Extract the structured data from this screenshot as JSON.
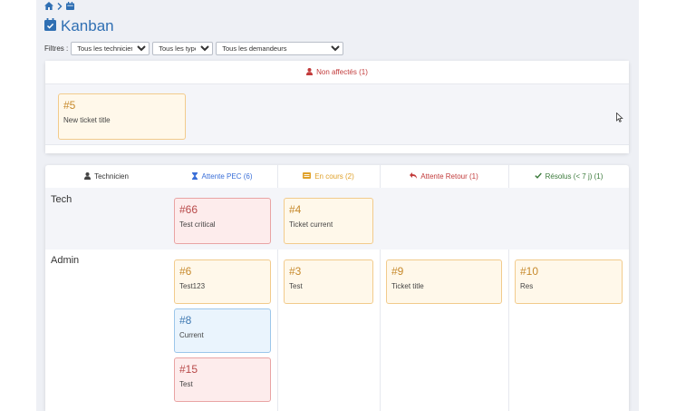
{
  "colors": {
    "link_blue": "#2f6fb3",
    "unassigned_red": "#c23b3b",
    "waiting_blue": "#3a6fd8",
    "in_progress_orange": "#e0a12a",
    "waiting_return_red": "#c23b3b",
    "resolved_green": "#3b7a3b"
  },
  "breadcrumb": {
    "home_icon": "home-icon",
    "separator_icon": "chevron-right-icon",
    "page_icon": "calendar-icon"
  },
  "page": {
    "title": "Kanban",
    "icon": "calendar-check-icon"
  },
  "filters": {
    "label": "Filtres :",
    "technicians": {
      "selected": "Tous les techniciens"
    },
    "types": {
      "selected": "Tous les types"
    },
    "requesters": {
      "selected": "Tous les demandeurs"
    }
  },
  "unassigned": {
    "title": "Non affectés (1)",
    "icon": "user-icon",
    "cards": [
      {
        "number": "#5",
        "title": "New ticket title",
        "color": "orange"
      }
    ]
  },
  "board": {
    "columns": [
      {
        "label": "Technicien",
        "icon": "user-icon"
      },
      {
        "label": "Attente PEC (6)",
        "icon": "hourglass-icon"
      },
      {
        "label": "En cours (2)",
        "icon": "list-icon"
      },
      {
        "label": "Attente Retour (1)",
        "icon": "reply-icon"
      },
      {
        "label": "Résolus (< 7 j) (1)",
        "icon": "check-icon"
      }
    ],
    "rows": [
      {
        "technician": "Tech",
        "cards": [
          {
            "number": "#66",
            "title": "Test critical",
            "color": "red"
          },
          {
            "number": "#4",
            "title": "Ticket current",
            "color": "orange"
          }
        ]
      },
      {
        "technician": "Admin",
        "cards": [
          {
            "number": "#6",
            "title": "Test123",
            "color": "orange"
          },
          {
            "number": "#8",
            "title": "Current",
            "color": "blue"
          },
          {
            "number": "#15",
            "title": "Test",
            "color": "red"
          },
          {
            "number": "#3",
            "title": "Test",
            "color": "orange"
          },
          {
            "number": "#9",
            "title": "Ticket title",
            "color": "orange"
          },
          {
            "number": "#10",
            "title": "Res",
            "color": "orange"
          }
        ]
      }
    ]
  }
}
